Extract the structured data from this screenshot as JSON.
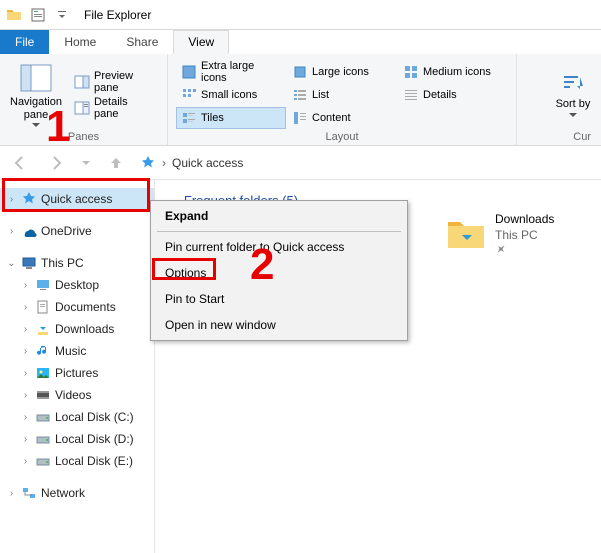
{
  "window": {
    "title": "File Explorer"
  },
  "tabs": {
    "file": "File",
    "home": "Home",
    "share": "Share",
    "view": "View"
  },
  "ribbon": {
    "panes": {
      "nav_label": "Navigation pane",
      "preview": "Preview pane",
      "details": "Details pane",
      "group_label": "Panes"
    },
    "layout": {
      "xl": "Extra large icons",
      "lg": "Large icons",
      "mi": "Medium icons",
      "sm": "Small icons",
      "list": "List",
      "det": "Details",
      "tiles": "Tiles",
      "content": "Content",
      "group_label": "Layout"
    },
    "sort": {
      "label": "Sort by"
    },
    "cur": {
      "label": "Cur"
    }
  },
  "address": {
    "crumb": "Quick access"
  },
  "tree": {
    "quick_access": "Quick access",
    "onedrive": "OneDrive",
    "this_pc": "This PC",
    "desktop": "Desktop",
    "documents": "Documents",
    "downloads": "Downloads",
    "music": "Music",
    "pictures": "Pictures",
    "videos": "Videos",
    "c": "Local Disk (C:)",
    "d": "Local Disk (D:)",
    "e": "Local Disk (E:)",
    "network": "Network"
  },
  "content": {
    "section": "Frequent folders (5)",
    "tile": {
      "name": "Downloads",
      "loc": "This PC",
      "pin": "📌"
    }
  },
  "ctx": {
    "expand": "Expand",
    "pin": "Pin current folder to Quick access",
    "options": "Options",
    "pin_start": "Pin to Start",
    "open_new": "Open in new window"
  },
  "anno": {
    "one": "1",
    "two": "2"
  }
}
